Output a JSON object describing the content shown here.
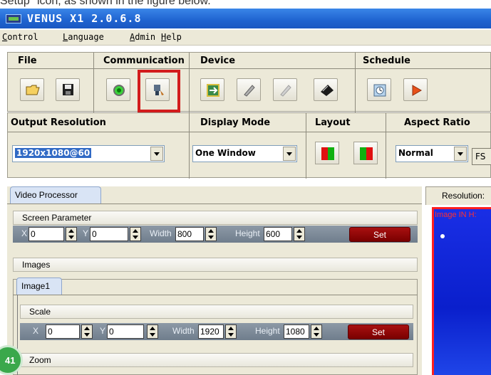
{
  "caption": "Setup\" icon, as shown in the figure below.",
  "window": {
    "title": "VENUS X1 2.0.6.8"
  },
  "menu": [
    "Control",
    "Language",
    "Admin",
    "Help"
  ],
  "toolbar": {
    "sections": {
      "file": "File",
      "communication": "Communication",
      "device": "Device",
      "schedule": "Schedule"
    }
  },
  "output": {
    "headers": {
      "output_resolution": "Output Resolution",
      "display_mode": "Display Mode",
      "layout": "Layout",
      "aspect_ratio": "Aspect Ratio"
    },
    "resolution_value": "1920x1080@60",
    "display_mode_value": "One Window",
    "aspect_ratio_value": "Normal",
    "fs_label": "FS"
  },
  "video_processor": {
    "tab": "Video Processor",
    "screen_parameter": {
      "title": "Screen Parameter",
      "x_label": "X",
      "x": "0",
      "y_label": "Y",
      "y": "0",
      "width_label": "Width",
      "width": "800",
      "height_label": "Height",
      "height": "600",
      "set": "Set"
    },
    "images_label": "Images",
    "image_tab": "Image1",
    "scale": {
      "title": "Scale",
      "x_label": "X",
      "x": "0",
      "y_label": "Y",
      "y": "0",
      "width_label": "Width",
      "width": "1920",
      "height_label": "Height",
      "height": "1080",
      "set": "Set"
    },
    "zoom_label": "Zoom"
  },
  "preview": {
    "tab": "Resolution:",
    "info": "Image IN H:"
  },
  "page_number": "41",
  "colors": {
    "highlight": "#d21c1c",
    "set_button": "#8b0000",
    "titlebar": "#1f63d0",
    "preview_bg": "#1030e0"
  }
}
